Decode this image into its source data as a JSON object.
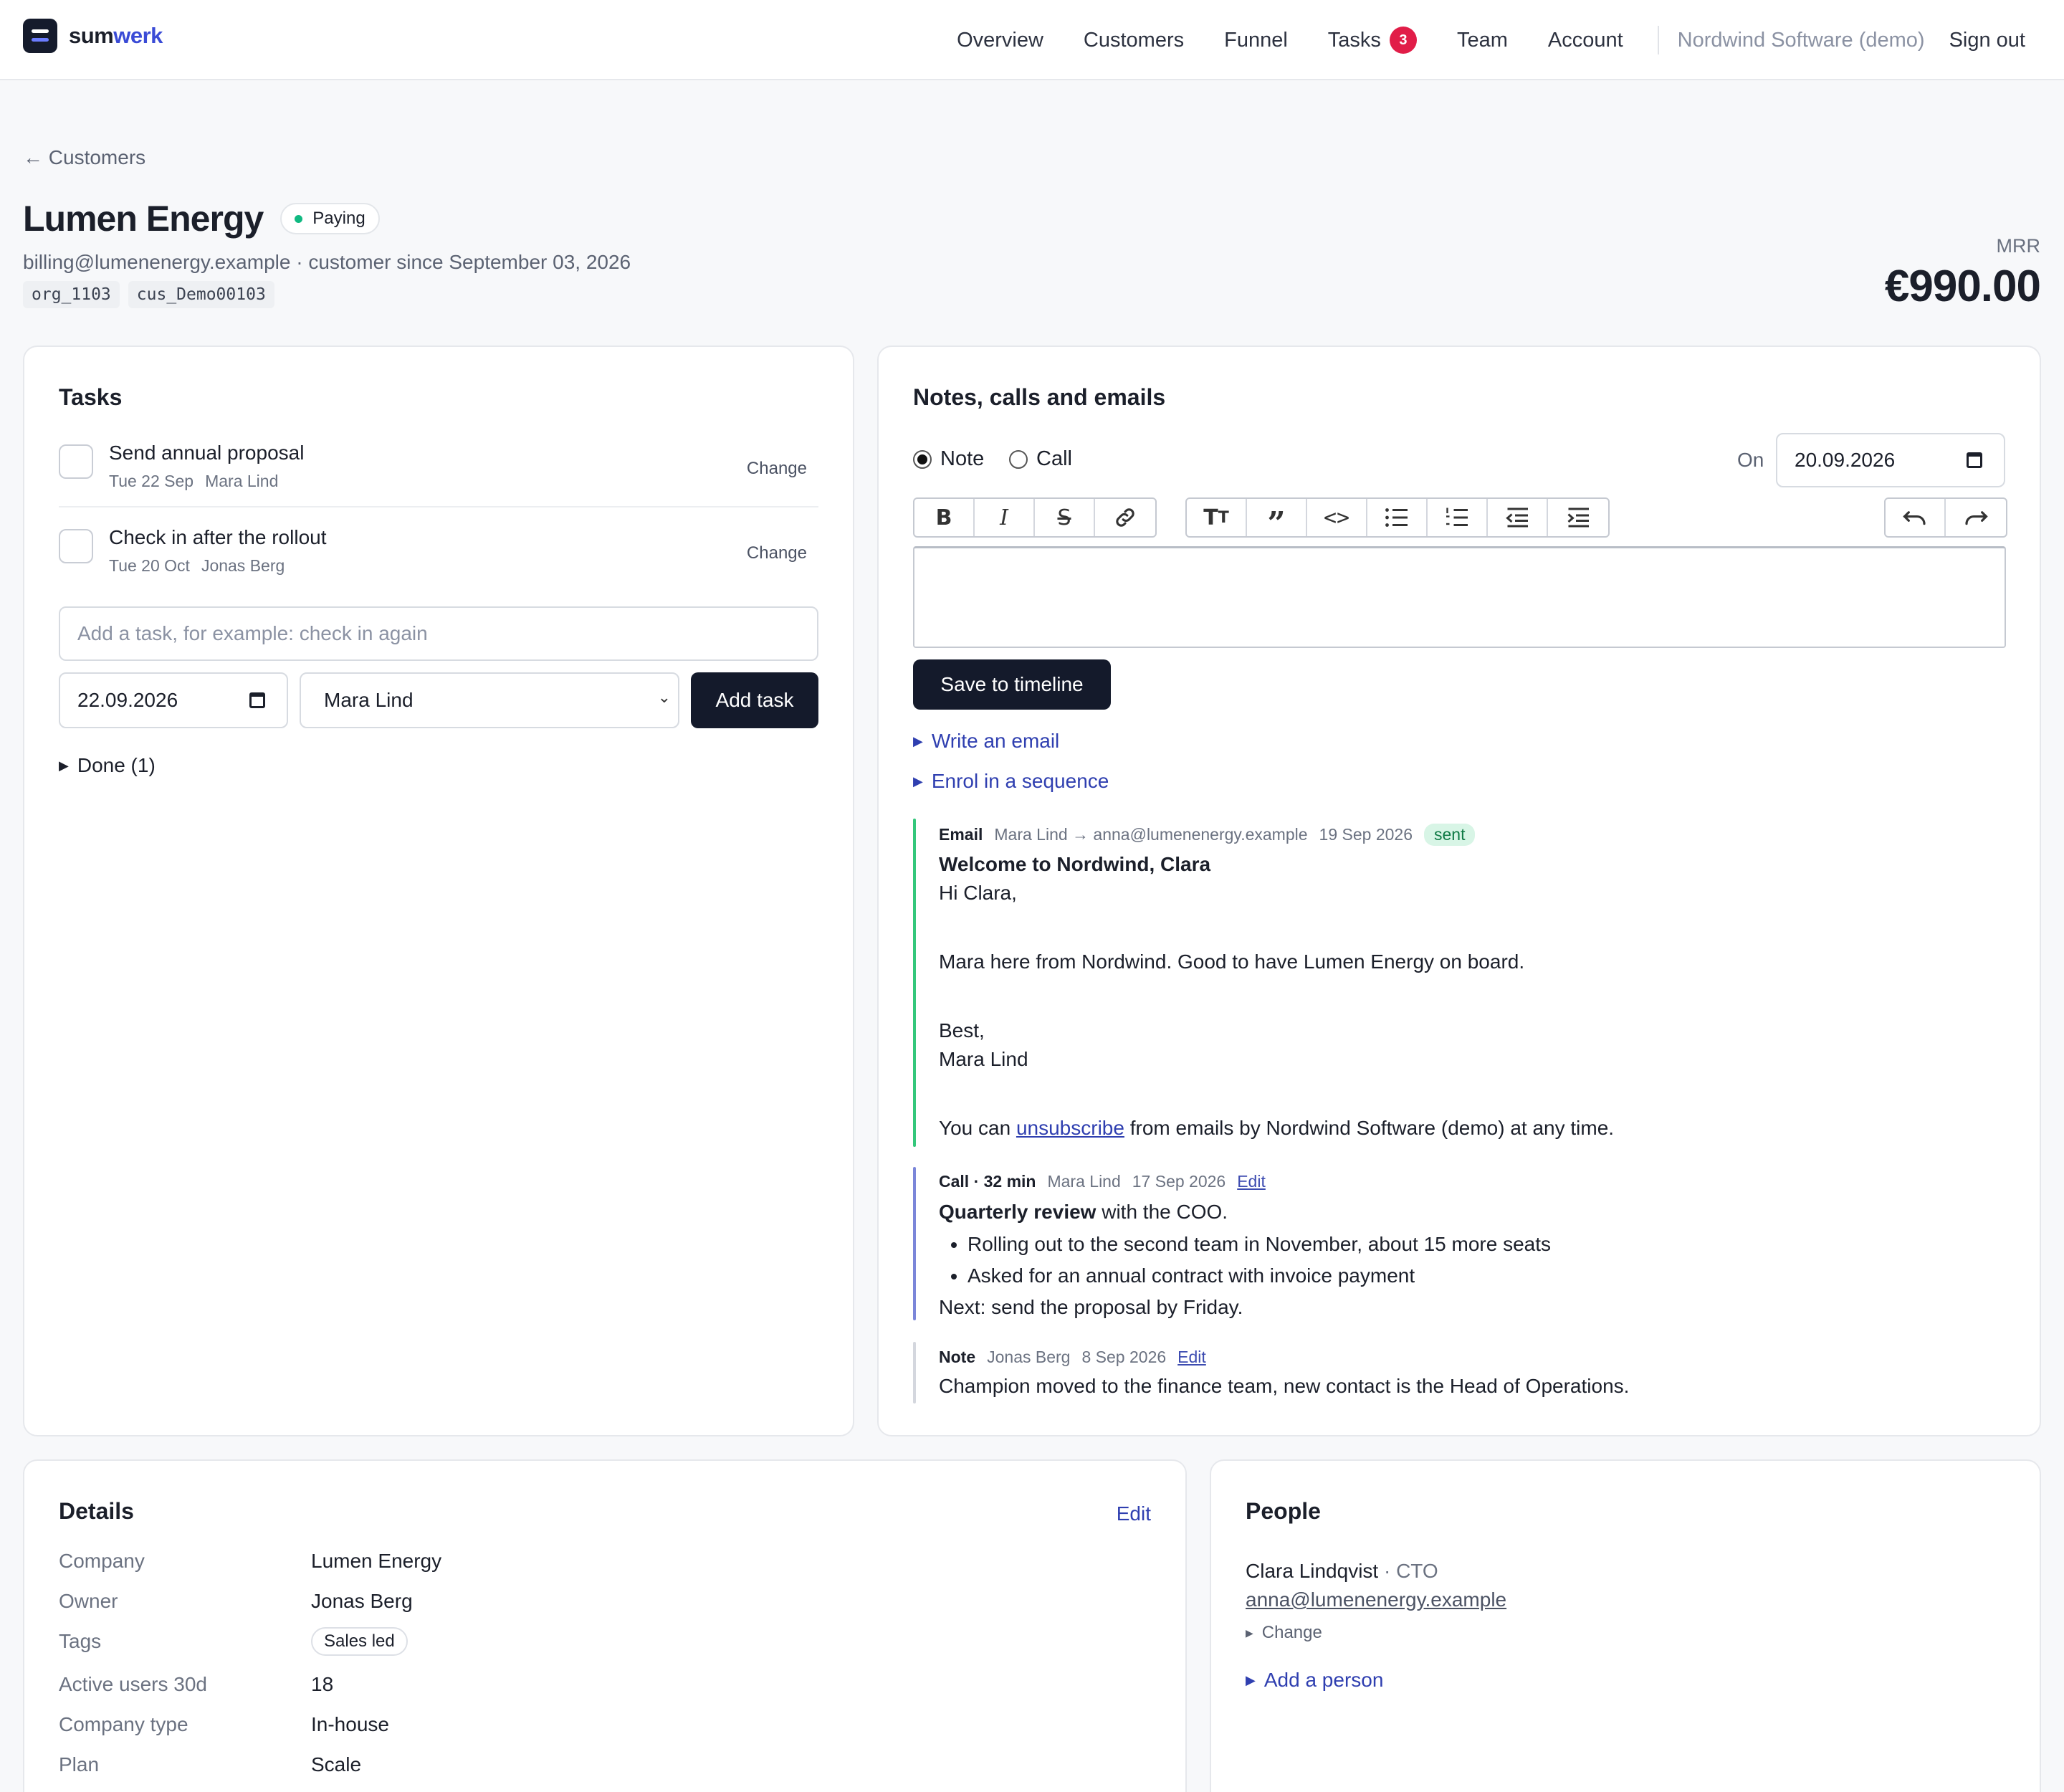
{
  "brand": {
    "name_a": "sum",
    "name_b": "werk"
  },
  "nav": {
    "overview": "Overview",
    "customers": "Customers",
    "funnel": "Funnel",
    "tasks": "Tasks",
    "tasks_count": "3",
    "team": "Team",
    "account": "Account",
    "org": "Nordwind Software (demo)",
    "signout": "Sign out"
  },
  "breadcrumb": {
    "back": "← Customers"
  },
  "customer": {
    "name": "Lumen Energy",
    "status": "Paying",
    "email_line": "billing@lumenenergy.example · customer since September 03, 2026",
    "org_id": "org_1103",
    "cus_id": "cus_Demo00103",
    "mrr_label": "MRR",
    "mrr_value": "€990.00"
  },
  "colors": {
    "accent": "#2f3fb0",
    "dark": "#141a2b",
    "success": "#10b981",
    "badge": "#e11d48",
    "email_bar": "#34c77b",
    "call_bar": "#7b86d9",
    "note_bar": "#d4d7de"
  },
  "tasks": {
    "title": "Tasks",
    "items": [
      {
        "title": "Send annual proposal",
        "date": "Tue 22 Sep",
        "owner": "Mara Lind",
        "action": "Change"
      },
      {
        "title": "Check in after the rollout",
        "date": "Tue 20 Oct",
        "owner": "Jonas Berg",
        "action": "Change"
      }
    ],
    "new_placeholder": "Add a task, for example: check in again",
    "date_value": "22.09.2026",
    "assignee_value": "Mara Lind",
    "add_label": "Add task",
    "done_label": "Done (1)"
  },
  "timeline": {
    "title": "Notes, calls and emails",
    "radio_note": "Note",
    "radio_call": "Call",
    "on_label": "On",
    "date_value": "20.09.2026",
    "save_label": "Save to timeline",
    "write_email": "Write an email",
    "enrol": "Enrol in a sequence",
    "toolbar_icons": [
      "bold-icon",
      "italic-icon",
      "strikethrough-icon",
      "link-icon",
      "heading-icon",
      "quote-icon",
      "code-icon",
      "bullet-list-icon",
      "numbered-list-icon",
      "outdent-icon",
      "indent-icon",
      "undo-icon",
      "redo-icon"
    ],
    "email": {
      "kind": "Email",
      "from_to": "Mara Lind → anna@lumenenergy.example",
      "date": "19 Sep 2026",
      "status": "sent",
      "subject": "Welcome to Nordwind, Clara",
      "greeting": "Hi Clara,",
      "body": "Mara here from Nordwind. Good to have Lumen Energy on board.",
      "signoff": "Best,",
      "signature": "Mara Lind",
      "unsub_pre": "You can ",
      "unsub_link": "unsubscribe",
      "unsub_post": " from emails by Nordwind Software (demo) at any time."
    },
    "call": {
      "kind": "Call · 32 min",
      "author": "Mara Lind",
      "date": "17 Sep 2026",
      "edit": "Edit",
      "headline_bold": "Quarterly review",
      "headline_rest": " with the COO.",
      "bullets": [
        "Rolling out to the second team in November, about 15 more seats",
        "Asked for an annual contract with invoice payment"
      ],
      "next": "Next: send the proposal by Friday."
    },
    "note": {
      "kind": "Note",
      "author": "Jonas Berg",
      "date": "8 Sep 2026",
      "edit": "Edit",
      "text": "Champion moved to the finance team, new contact is the Head of Operations."
    }
  },
  "details": {
    "title": "Details",
    "edit": "Edit",
    "rows": [
      {
        "k": "Company",
        "v": "Lumen Energy"
      },
      {
        "k": "Owner",
        "v": "Jonas Berg"
      },
      {
        "k": "Tags",
        "v": "Sales led"
      },
      {
        "k": "Active users 30d",
        "v": "18"
      },
      {
        "k": "Company type",
        "v": "In-house"
      },
      {
        "k": "Plan",
        "v": "Scale"
      }
    ]
  },
  "people": {
    "title": "People",
    "name": "Clara Lindqvist",
    "role": " · CTO",
    "email": "anna@lumenenergy.example",
    "change": "Change",
    "add": "Add a person"
  }
}
